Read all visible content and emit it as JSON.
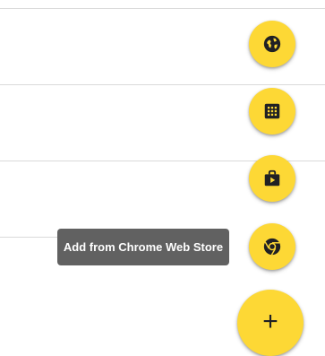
{
  "tooltip": {
    "text": "Add from Chrome Web Store"
  },
  "fab": {
    "main_label": "+",
    "actions": [
      {
        "icon": "globe-icon"
      },
      {
        "icon": "grid-apps-icon"
      },
      {
        "icon": "shopping-bag-icon"
      },
      {
        "icon": "chrome-icon"
      }
    ]
  },
  "colors": {
    "fab_background": "#fdd835",
    "icon": "#202124",
    "tooltip_background": "#616161",
    "divider": "#dadada"
  }
}
